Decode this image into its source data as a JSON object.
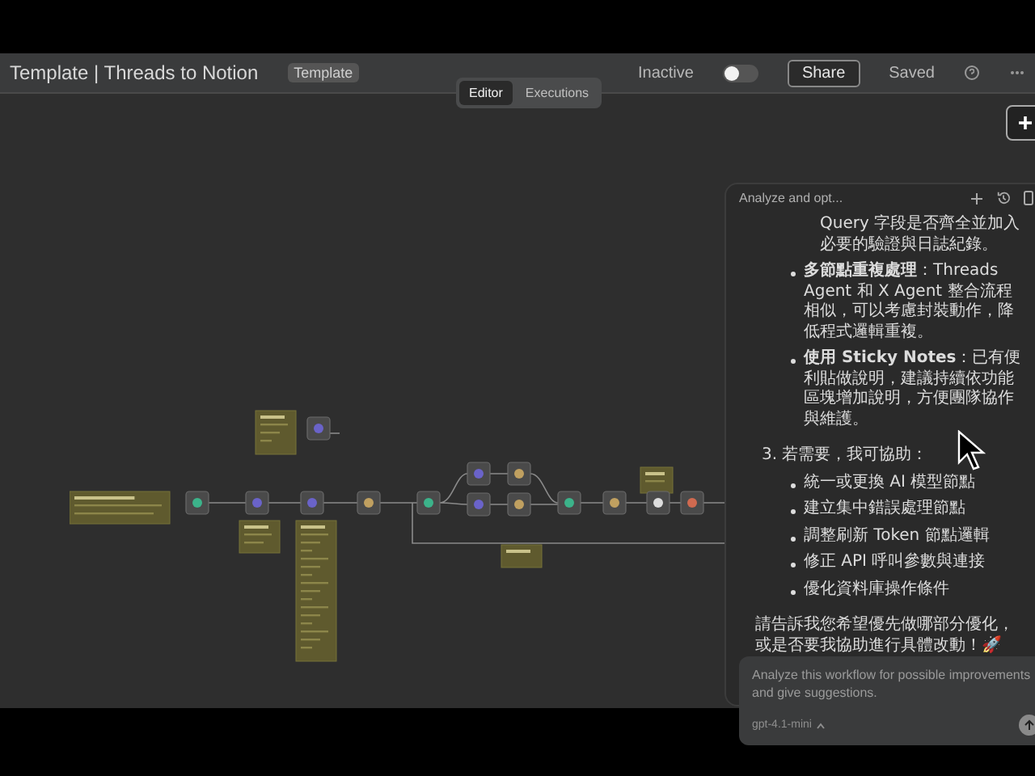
{
  "header": {
    "title": "Template | Threads to Notion",
    "badge": "Template",
    "active_label": "Inactive",
    "active": false,
    "share": "Share",
    "save_status": "Saved"
  },
  "view_tabs": [
    {
      "label": "Editor",
      "selected": true
    },
    {
      "label": "Executions",
      "selected": false
    }
  ],
  "chat": {
    "title": "Analyze and opt...",
    "blocks": [
      {
        "kind": "continuation",
        "text": "Query 字段是否齊全並加入必要的驗證與日誌紀錄。"
      },
      {
        "kind": "bullet",
        "text": "**多節點重複處理**：Threads Agent 和 X Agent 整合流程相似，可以考慮封裝動作，降低程式邏輯重複。"
      },
      {
        "kind": "bullet",
        "text": "**使用 Sticky Notes**：已有便利貼做說明，建議持續依功能區塊增加說明，方便團隊協作與維護。"
      },
      {
        "kind": "numbered",
        "text": "3. 若需要，我可協助：",
        "children": [
          {
            "kind": "bullet",
            "text": "統一或更換 AI 模型節點"
          },
          {
            "kind": "bullet",
            "text": "建立集中錯誤處理節點"
          },
          {
            "kind": "bullet",
            "text": "調整刷新 Token 節點邏輯"
          },
          {
            "kind": "bullet",
            "text": "修正 API 呼叫參數與連接"
          },
          {
            "kind": "bullet",
            "text": "優化資料庫操作條件"
          }
        ]
      },
      {
        "kind": "paragraph",
        "text": "請告訴我您希望優先做哪部分優化，或是否要我協助進行具體改動！🚀"
      }
    ],
    "input": {
      "value": "Analyze this workflow for possible improvements and give suggestions.",
      "model": "gpt-4.1-mini"
    }
  }
}
